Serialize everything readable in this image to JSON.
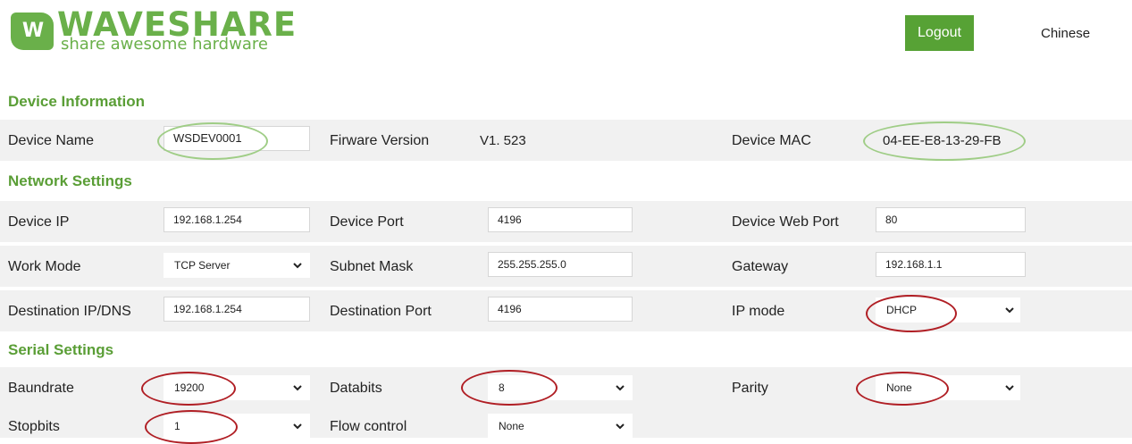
{
  "header": {
    "logo_mark": "W",
    "logo_word": "WAVESHARE",
    "logo_tagline": "share awesome hardware",
    "logout_label": "Logout",
    "language_label": "Chinese"
  },
  "device_info": {
    "title": "Device Information",
    "device_name_label": "Device Name",
    "device_name_value": "WSDEV0001",
    "firmware_label": "Firware Version",
    "firmware_value": "V1. 523",
    "mac_label": "Device MAC",
    "mac_value": "04-EE-E8-13-29-FB"
  },
  "network": {
    "title": "Network Settings",
    "device_ip_label": "Device IP",
    "device_ip_value": "192.168.1.254",
    "device_port_label": "Device Port",
    "device_port_value": "4196",
    "web_port_label": "Device Web Port",
    "web_port_value": "80",
    "work_mode_label": "Work Mode",
    "work_mode_value": "TCP Server",
    "subnet_label": "Subnet Mask",
    "subnet_value": "255.255.255.0",
    "gateway_label": "Gateway",
    "gateway_value": "192.168.1.1",
    "dest_ip_label": "Destination IP/DNS",
    "dest_ip_value": "192.168.1.254",
    "dest_port_label": "Destination Port",
    "dest_port_value": "4196",
    "ip_mode_label": "IP mode",
    "ip_mode_value": "DHCP"
  },
  "serial": {
    "title": "Serial Settings",
    "baudrate_label": "Baundrate",
    "baudrate_value": "19200",
    "databits_label": "Databits",
    "databits_value": "8",
    "parity_label": "Parity",
    "parity_value": "None",
    "stopbits_label": "Stopbits",
    "stopbits_value": "1",
    "flow_label": "Flow control",
    "flow_value": "None"
  },
  "colors": {
    "brand_green": "#6ab04a",
    "button_green": "#57a235",
    "highlight_green": "#9fcd86",
    "highlight_red": "#b01e24"
  }
}
